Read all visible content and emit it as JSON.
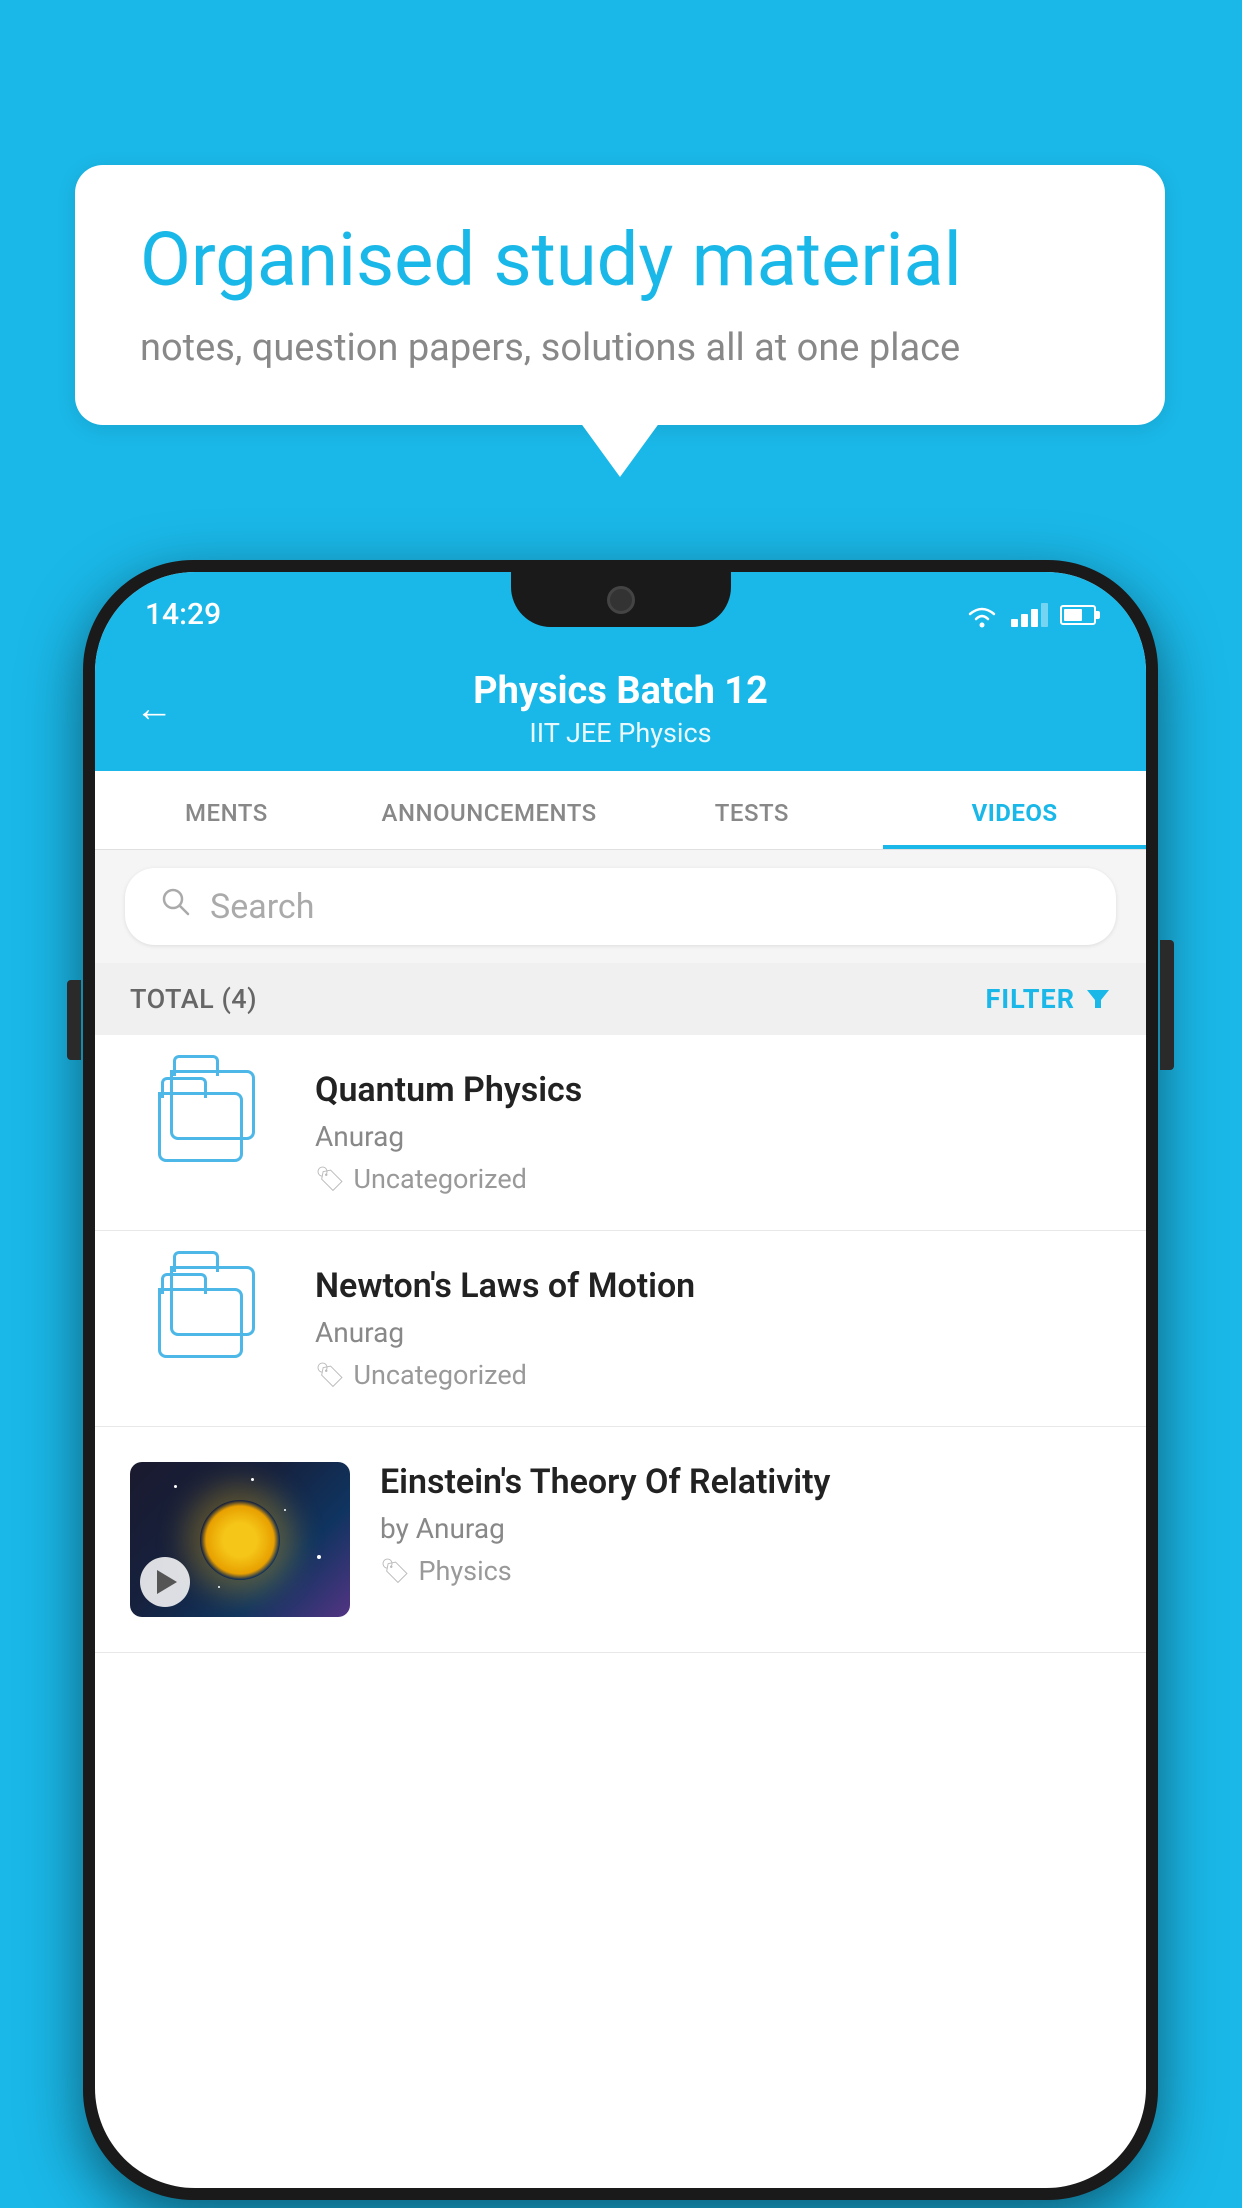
{
  "background_color": "#1ab8e8",
  "bubble": {
    "title": "Organised study material",
    "subtitle": "notes, question papers, solutions all at one place"
  },
  "status_bar": {
    "time": "14:29",
    "wifi": "▼",
    "battery": "65"
  },
  "header": {
    "title": "Physics Batch 12",
    "subtitle": "IIT JEE   Physics",
    "back_label": "←"
  },
  "tabs": [
    {
      "label": "MENTS",
      "active": false
    },
    {
      "label": "ANNOUNCEMENTS",
      "active": false
    },
    {
      "label": "TESTS",
      "active": false
    },
    {
      "label": "VIDEOS",
      "active": true
    }
  ],
  "search": {
    "placeholder": "Search"
  },
  "filter": {
    "total_label": "TOTAL (4)",
    "filter_label": "FILTER"
  },
  "videos": [
    {
      "id": 1,
      "title": "Quantum Physics",
      "author": "Anurag",
      "tag": "Uncategorized",
      "has_thumbnail": false
    },
    {
      "id": 2,
      "title": "Newton's Laws of Motion",
      "author": "Anurag",
      "tag": "Uncategorized",
      "has_thumbnail": false
    },
    {
      "id": 3,
      "title": "Einstein's Theory Of Relativity",
      "author": "by Anurag",
      "tag": "Physics",
      "has_thumbnail": true
    }
  ]
}
